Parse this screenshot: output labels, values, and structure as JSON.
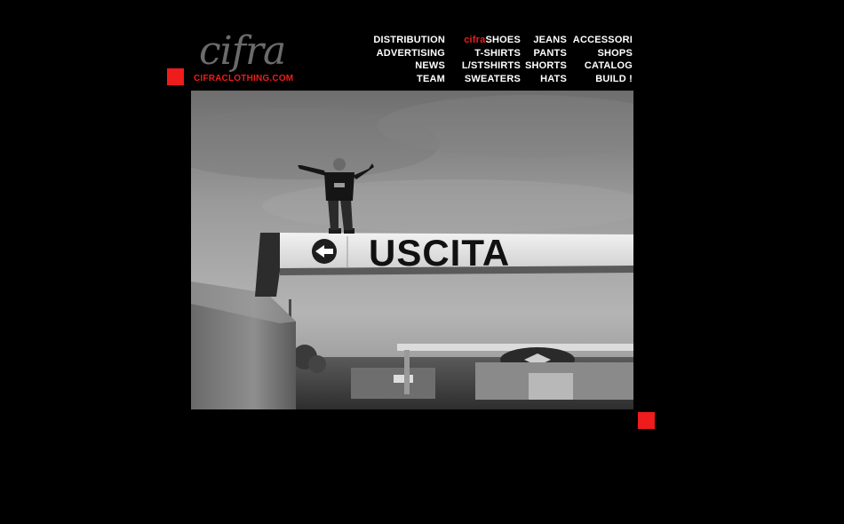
{
  "logo": {
    "script_text": "cifra",
    "url_text": "CIFRACLOTHING.COM"
  },
  "nav": {
    "columns": [
      [
        {
          "label": "DISTRIBUTION"
        },
        {
          "label": "ADVERTISING"
        },
        {
          "label": "NEWS"
        },
        {
          "label": "TEAM"
        }
      ],
      [
        {
          "accent": "cifra",
          "label": "SHOES"
        },
        {
          "label": "T-SHIRTS"
        },
        {
          "label": "L/STSHIRTS"
        },
        {
          "label": "SWEATERS"
        }
      ],
      [
        {
          "label": "JEANS"
        },
        {
          "label": "PANTS"
        },
        {
          "label": "SHORTS"
        },
        {
          "label": "HATS"
        }
      ],
      [
        {
          "label": "ACCESSORI"
        },
        {
          "label": "SHOPS"
        },
        {
          "label": "CATALOG"
        },
        {
          "label": "BUILD !"
        }
      ]
    ]
  },
  "photo": {
    "sign_text": "USCITA"
  },
  "colors": {
    "background": "#000000",
    "accent": "#ee1c1c",
    "nav_text": "#ffffff",
    "logo_script": "#6b6b6b"
  }
}
